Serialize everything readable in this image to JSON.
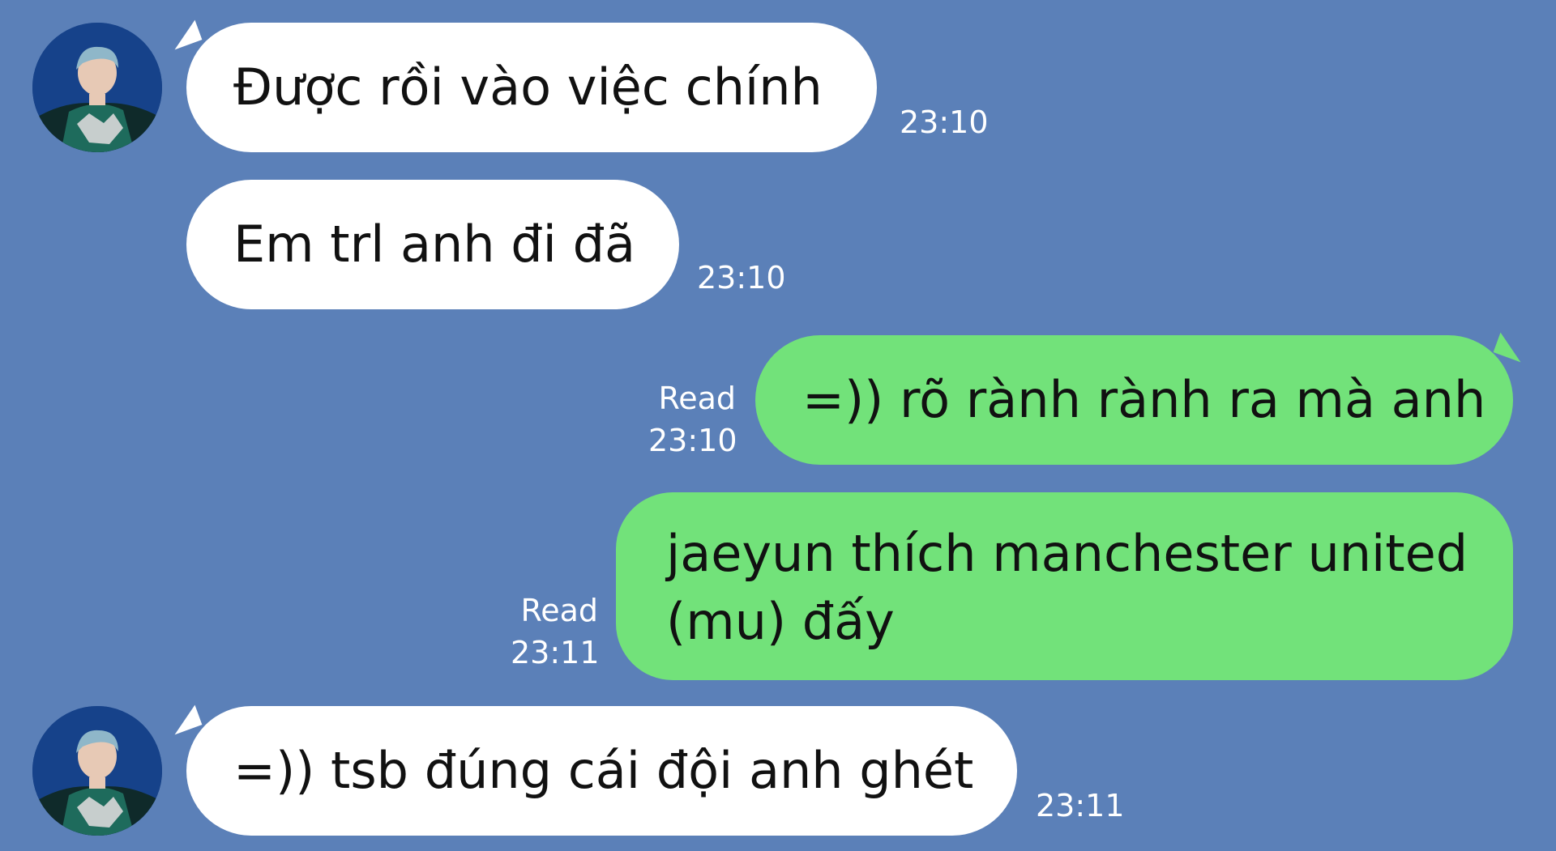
{
  "colors": {
    "background": "#5b80b8",
    "incoming_bubble": "#ffffff",
    "outgoing_bubble": "#72e27a",
    "meta_text": "#ffffff"
  },
  "messages": [
    {
      "direction": "incoming",
      "text": "Được rồi vào việc chính",
      "time": "23:10",
      "avatar": "avatar-photo"
    },
    {
      "direction": "incoming",
      "text": "Em trl anh đi đã",
      "time": "23:10"
    },
    {
      "direction": "outgoing",
      "text": "=)) rõ rành rành ra mà anh",
      "status": "Read",
      "time": "23:10"
    },
    {
      "direction": "outgoing",
      "text_line1": "jaeyun thích manchester united",
      "text_line2": "(mu) đấy",
      "status": "Read",
      "time": "23:11"
    },
    {
      "direction": "incoming",
      "text": "=)) tsb đúng cái đội anh ghét",
      "time": "23:11",
      "avatar": "avatar-photo"
    }
  ]
}
